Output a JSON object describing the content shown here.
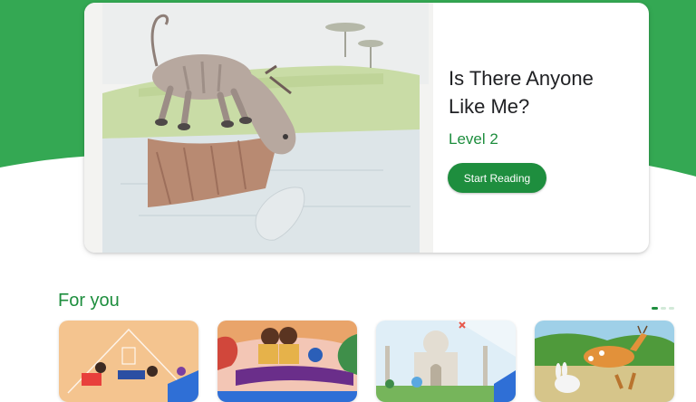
{
  "colors": {
    "brand_green": "#1e8e3e",
    "hero_background": "#34a853",
    "card_background": "#ffffff",
    "title_text": "#202124"
  },
  "hero": {
    "book_title_line1": "Is There Anyone",
    "book_title_line2": "Like Me?",
    "level": "Level 2",
    "start_button_label": "Start Reading"
  },
  "for_you": {
    "title": "For you",
    "pager": {
      "pages": 3,
      "active_index": 0
    },
    "books": [
      {
        "cover": "house-family-cover"
      },
      {
        "cover": "children-on-tree-cover"
      },
      {
        "cover": "taj-mahal-cover"
      },
      {
        "cover": "deer-rabbit-cover"
      }
    ]
  }
}
